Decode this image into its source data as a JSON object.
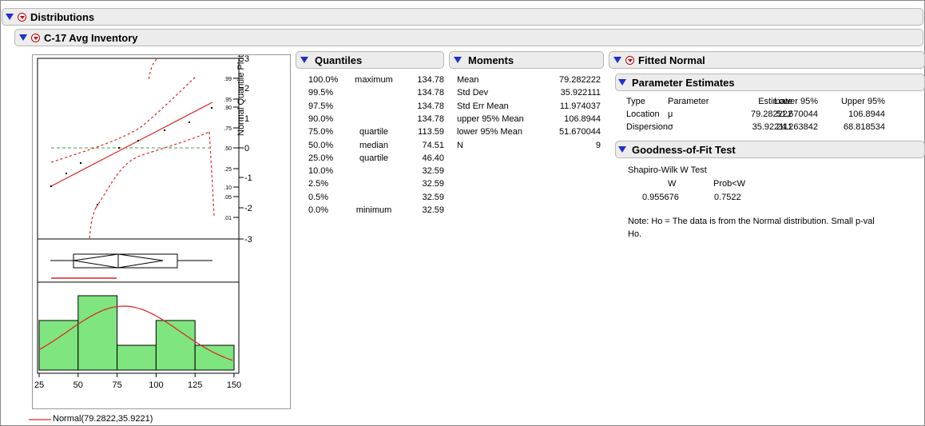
{
  "window": {
    "title": "Distributions",
    "variable": "C-17 Avg Inventory"
  },
  "quantile_plot": {
    "label": "Normal Quantile Plot",
    "right_ticks": [
      "3",
      "2",
      "1",
      "0",
      "-1",
      "-2",
      "-3"
    ],
    "prob_ticks": [
      ".99",
      ".95",
      ".90",
      ".75",
      ".50",
      ".25",
      ".10",
      ".05",
      ".01"
    ]
  },
  "histogram": {
    "x_ticks": [
      "25",
      "50",
      "75",
      "100",
      "125",
      "150"
    ],
    "legend": "Normal(79.2822,35.9221)"
  },
  "chart_data": {
    "type": "bar",
    "categories": [
      "25-50",
      "50-75",
      "75-100",
      "100-125",
      "125-150"
    ],
    "values": [
      2,
      3,
      1,
      2,
      1
    ],
    "xlim": [
      25,
      150
    ]
  },
  "quantiles": {
    "title": "Quantiles",
    "rows": [
      {
        "pct": "100.0%",
        "label": "maximum",
        "value": "134.78"
      },
      {
        "pct": "99.5%",
        "label": "",
        "value": "134.78"
      },
      {
        "pct": "97.5%",
        "label": "",
        "value": "134.78"
      },
      {
        "pct": "90.0%",
        "label": "",
        "value": "134.78"
      },
      {
        "pct": "75.0%",
        "label": "quartile",
        "value": "113.59"
      },
      {
        "pct": "50.0%",
        "label": "median",
        "value": "74.51"
      },
      {
        "pct": "25.0%",
        "label": "quartile",
        "value": "46.40"
      },
      {
        "pct": "10.0%",
        "label": "",
        "value": "32.59"
      },
      {
        "pct": "2.5%",
        "label": "",
        "value": "32.59"
      },
      {
        "pct": "0.5%",
        "label": "",
        "value": "32.59"
      },
      {
        "pct": "0.0%",
        "label": "minimum",
        "value": "32.59"
      }
    ]
  },
  "moments": {
    "title": "Moments",
    "rows": [
      {
        "label": "Mean",
        "value": "79.282222"
      },
      {
        "label": "Std Dev",
        "value": "35.922111"
      },
      {
        "label": "Std Err Mean",
        "value": "11.974037"
      },
      {
        "label": "upper 95% Mean",
        "value": "106.8944"
      },
      {
        "label": "lower 95% Mean",
        "value": "51.670044"
      },
      {
        "label": "N",
        "value": "9"
      }
    ]
  },
  "fitted": {
    "title": "Fitted Normal",
    "param_title": "Parameter Estimates",
    "param_headers": [
      "Type",
      "Parameter",
      "Estimate",
      "Lower 95%",
      "Upper 95%"
    ],
    "param_rows": [
      {
        "type": "Location",
        "param": "μ",
        "estimate": "79.282222",
        "lower": "51.670044",
        "upper": "106.8944"
      },
      {
        "type": "Dispersion",
        "param": "σ",
        "estimate": "35.922111",
        "lower": "24.263842",
        "upper": "68.818534"
      }
    ],
    "gof_title": "Goodness-of-Fit Test",
    "gof_test": "Shapiro-Wilk W Test",
    "gof_headers": [
      "W",
      "Prob<W"
    ],
    "gof_values": [
      "0.955676",
      "0.7522"
    ],
    "note_line1": "Note: Ho = The data is from the Normal distribution. Small p-val",
    "note_line2": "Ho."
  }
}
